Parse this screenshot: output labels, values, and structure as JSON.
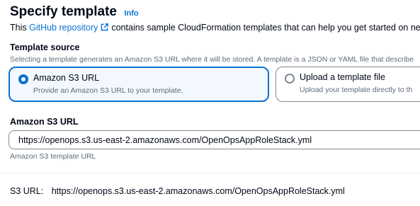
{
  "header": {
    "title": "Specify template",
    "info_link": "Info"
  },
  "description": {
    "prefix": "This ",
    "link_text": "GitHub repository",
    "suffix": "contains sample CloudFormation templates that can help you get started on ne"
  },
  "template_source": {
    "label": "Template source",
    "description": "Selecting a template generates an Amazon S3 URL where it will be stored. A template is a JSON or YAML file that describe",
    "options": [
      {
        "title": "Amazon S3 URL",
        "description": "Provide an Amazon S3 URL to your template.",
        "selected": true
      },
      {
        "title": "Upload a template file",
        "description": "Upload your template directly to th",
        "selected": false
      }
    ]
  },
  "s3_field": {
    "label": "Amazon S3 URL",
    "value": "https://openops.s3.us-east-2.amazonaws.com/OpenOpsAppRoleStack.yml",
    "help": "Amazon S3 template URL"
  },
  "s3_url_summary": {
    "label": "S3 URL:",
    "value": "https://openops.s3.us-east-2.amazonaws.com/OpenOpsAppRoleStack.yml"
  },
  "colors": {
    "link": "#0972d3",
    "selected_border": "#0972d3",
    "selected_bg": "#f2f8fd",
    "muted_text": "#5f6b7a",
    "border": "#7d8998"
  },
  "icons": {
    "external_link": "external-link-icon"
  }
}
